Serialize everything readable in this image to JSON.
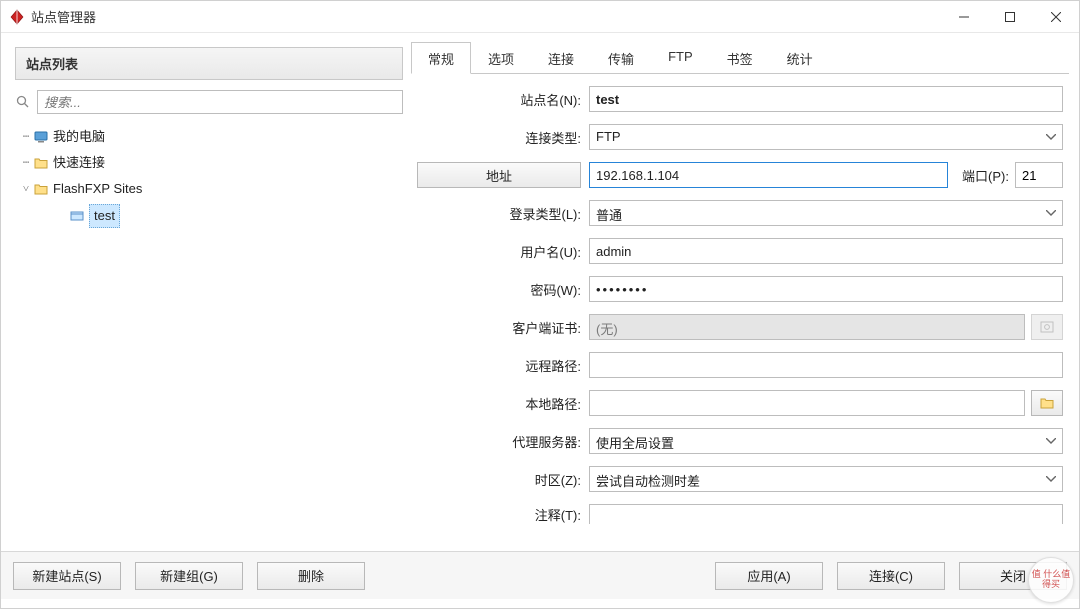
{
  "window": {
    "title": "站点管理器"
  },
  "left": {
    "header": "站点列表",
    "search_placeholder": "搜索...",
    "tree": {
      "mypc": "我的电脑",
      "quick": "快速连接",
      "sites": "FlashFXP Sites",
      "site0": "test"
    }
  },
  "tabs": [
    "常规",
    "选项",
    "连接",
    "传输",
    "FTP",
    "书签",
    "统计"
  ],
  "form": {
    "site_name_label": "站点名(N):",
    "site_name": "test",
    "conn_type_label": "连接类型:",
    "conn_type": "FTP",
    "address_btn": "地址",
    "address": "192.168.1.104",
    "port_label": "端口(P):",
    "port": "21",
    "login_type_label": "登录类型(L):",
    "login_type": "普通",
    "username_label": "用户名(U):",
    "username": "admin",
    "password_label": "密码(W):",
    "password": "••••••••",
    "cert_label": "客户端证书:",
    "cert": "(无)",
    "remote_path_label": "远程路径:",
    "remote_path": "",
    "local_path_label": "本地路径:",
    "local_path": "",
    "proxy_label": "代理服务器:",
    "proxy": "使用全局设置",
    "tz_label": "时区(Z):",
    "tz": "尝试自动检测时差",
    "notes_label": "注释(T):"
  },
  "buttons": {
    "new_site": "新建站点(S)",
    "new_group": "新建组(G)",
    "delete": "删除",
    "apply": "应用(A)",
    "connect": "连接(C)",
    "close": "关闭"
  },
  "watermark": "值 什么值得买"
}
